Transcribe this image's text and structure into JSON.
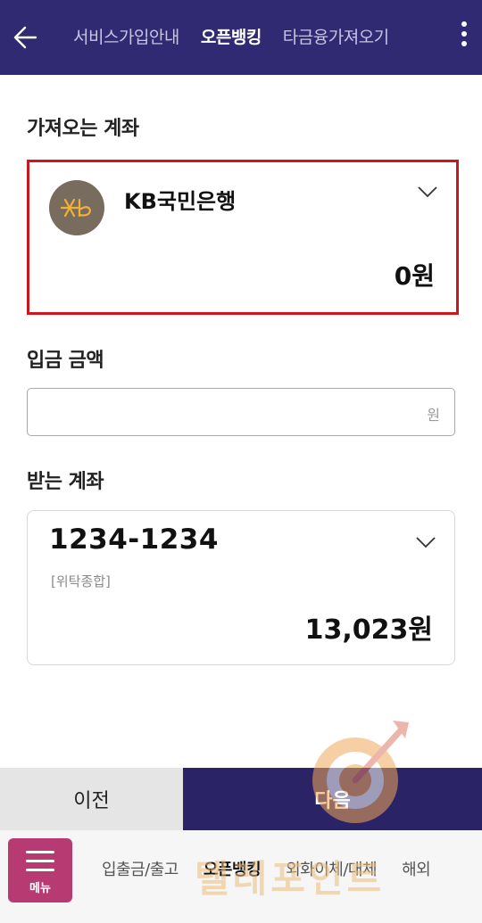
{
  "header": {
    "back_icon": "arrow-left-icon",
    "tabs": [
      {
        "label": "서비스가입안내",
        "active": false
      },
      {
        "label": "오픈뱅킹",
        "active": true
      },
      {
        "label": "타금융가져오기",
        "active": false
      }
    ],
    "more_icon": "kebab-menu-icon"
  },
  "from_account": {
    "section_label": "가져오는 계좌",
    "bank_name": "KB국민은행",
    "bank_logo_text": "KB",
    "amount": "0원",
    "highlight_color": "#c8191f"
  },
  "deposit": {
    "section_label": "입금 금액",
    "value": "",
    "unit": "원"
  },
  "to_account": {
    "section_label": "받는 계좌",
    "account_number": "1234-1234",
    "account_type": "[위탁종합]",
    "amount": "13,023원"
  },
  "buttons": {
    "prev_label": "이전",
    "next_label": "다음"
  },
  "bottom_nav": {
    "menu_label": "메뉴",
    "items": [
      {
        "label": "입출금/출고",
        "active": false
      },
      {
        "label": "오픈뱅킹",
        "active": true
      },
      {
        "label": "외화이체/대체",
        "active": false
      },
      {
        "label": "해외",
        "active": false
      }
    ]
  },
  "watermark_text": "텔레포인트",
  "colors": {
    "header_bg": "#2f2a72",
    "next_button_bg": "#2a2365",
    "menu_button_bg": "#b83a72"
  }
}
